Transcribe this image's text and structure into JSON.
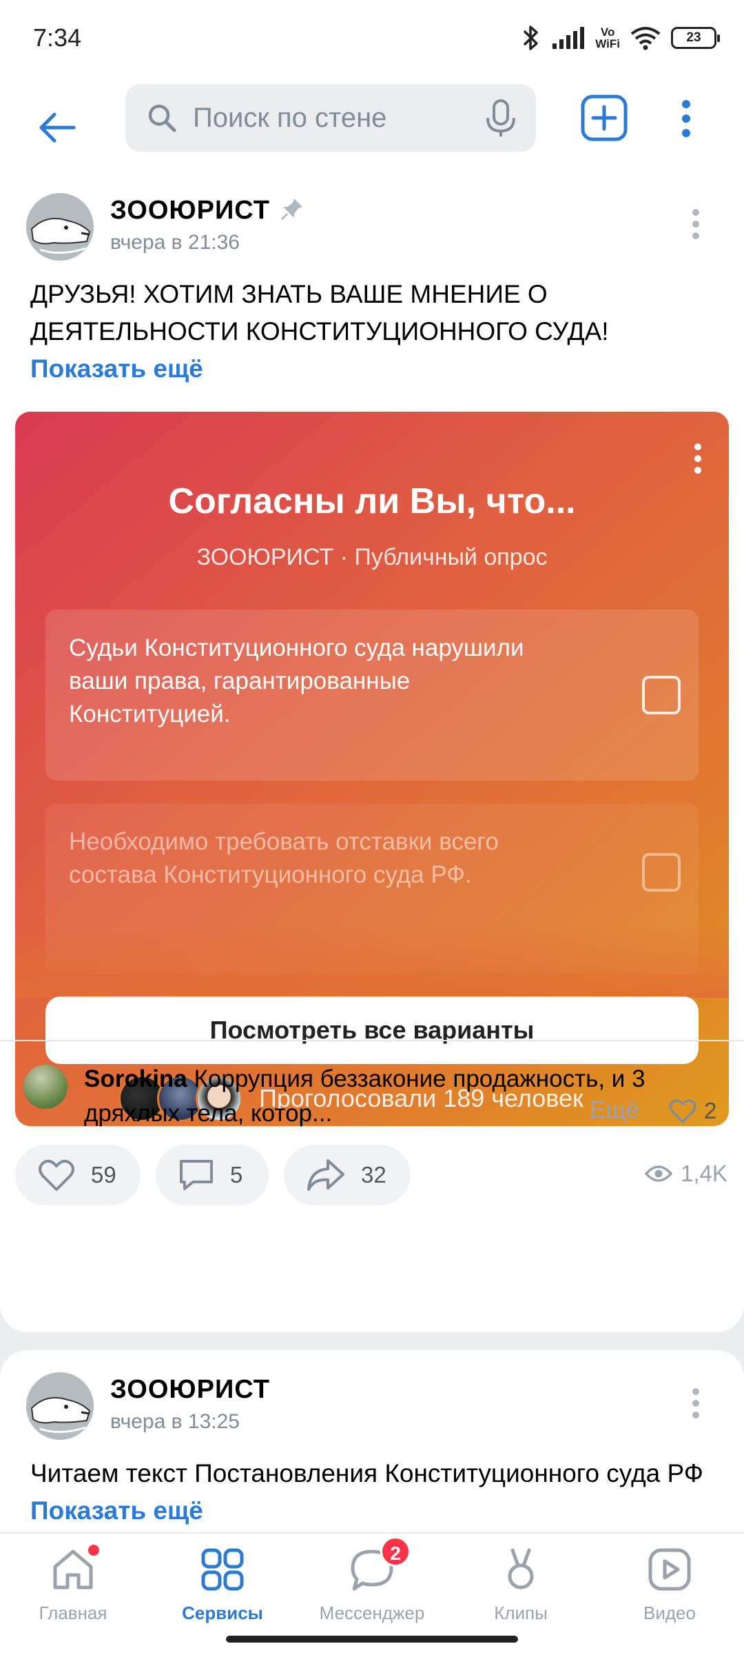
{
  "status": {
    "time": "7:34",
    "vowifi_top": "Vo",
    "vowifi_bottom": "WiFi",
    "battery": "23"
  },
  "header": {
    "search_placeholder": "Поиск по стене"
  },
  "post1": {
    "author": "ЗООЮРИСТ",
    "time": "вчера в 21:36",
    "text": "ДРУЗЬЯ! ХОТИМ ЗНАТЬ ВАШЕ МНЕНИЕ О ДЕЯТЕЛЬНОСТИ КОНСТИТУЦИОННОГО СУДА!",
    "show_more": "Показать ещё",
    "poll": {
      "title": "Согласны ли Вы, что...",
      "subtitle": "ЗООЮРИСТ · Публичный опрос",
      "options": [
        "Судьи Конституционного суда нарушили ваши права, гарантированные Конституцией.",
        "Необходимо требовать отставки всего состава Конституционного суда РФ."
      ],
      "view_all": "Посмотреть все варианты",
      "voted": "Проголосовали 189 человек"
    },
    "likes": "59",
    "comments": "5",
    "shares": "32",
    "views": "1,4K",
    "comment": {
      "author": "Sorokina",
      "text": "Коррупция беззаконие продажность, и 3 дряхлых тела, котор...",
      "more": "Ещё",
      "likes": "2"
    }
  },
  "post2": {
    "author": "ЗООЮРИСТ",
    "time": "вчера в 13:25",
    "text": "Читаем текст Постановления Конституционного суда РФ",
    "show_more": "Показать ещё"
  },
  "nav": {
    "items": [
      {
        "label": "Главная"
      },
      {
        "label": "Сервисы"
      },
      {
        "label": "Мессенджер"
      },
      {
        "label": "Клипы"
      },
      {
        "label": "Видео"
      }
    ],
    "messenger_badge": "2",
    "active_color": "#2a7ad6",
    "inactive_color": "#99a2ad"
  }
}
